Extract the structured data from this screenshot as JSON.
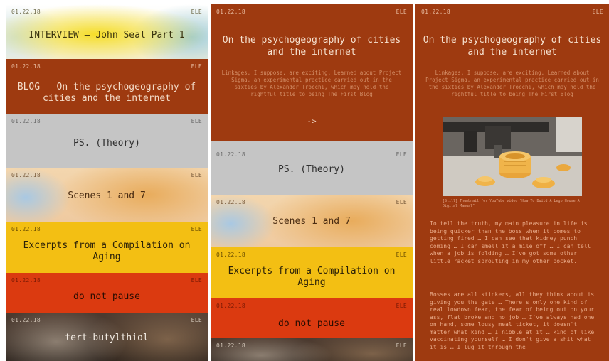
{
  "colors": {
    "rust": "#9e3a10",
    "gray": "#c5c5c5",
    "yellow": "#f3bf13",
    "red": "#db3a10",
    "white": "#ffffff"
  },
  "panel1": {
    "cards": [
      {
        "date": "01.22.18",
        "author": "ELE",
        "title": "INTERVIEW – John Seal Part 1"
      },
      {
        "date": "01.22.18",
        "author": "ELE",
        "title": "BLOG – On the psychogeography of cities and the internet"
      },
      {
        "date": "01.22.18",
        "author": "ELE",
        "title": "PS. (Theory)"
      },
      {
        "date": "01.22.18",
        "author": "ELE",
        "title": "Scenes 1 and 7"
      },
      {
        "date": "01.22.18",
        "author": "ELE",
        "title": "Excerpts from a Compilation on Aging"
      },
      {
        "date": "01.22.18",
        "author": "ELE",
        "title": "do not pause"
      },
      {
        "date": "01.22.18",
        "author": "ELE",
        "title": "tert-butylthiol"
      }
    ]
  },
  "panel2": {
    "expanded": {
      "date": "01.22.18",
      "author": "ELE",
      "title": "On the psychogeography of cities and the internet",
      "excerpt": "Linkages, I suppose, are exciting. Learned about Project Sigma, an experimental practice carried out in the sixties by Alexander Trocchi, which may hold the rightful title to being The First Blog",
      "arrow": "->"
    },
    "cards": [
      {
        "date": "01.22.18",
        "author": "ELE",
        "title": "PS. (Theory)"
      },
      {
        "date": "01.22.18",
        "author": "ELE",
        "title": "Scenes 1 and 7"
      },
      {
        "date": "01.22.18",
        "author": "ELE",
        "title": "Excerpts from a Compilation on Aging"
      },
      {
        "date": "01.22.18",
        "author": "ELE",
        "title": "do not pause"
      },
      {
        "date": "01.22.18",
        "author": "ELE",
        "title": ""
      }
    ]
  },
  "panel3": {
    "date": "01.22.18",
    "author": "ELE",
    "title": "On the psychogeography of cities and the internet",
    "excerpt": "Linkages, I suppose, are exciting. Learned about Project Sigma, an experimental practice carried out in the sixties by Alexander Trocchi, which may hold the rightful title to being The First Blog",
    "image_caption": "[Still] Thumbnail for YouTube video \"How To Build A Lego House A Digital Manual\"",
    "paragraph1": "To tell the truth, my main pleasure in life is being quicker than the boss when it comes to getting fired … I can see that kidney punch coming … I can smell it a mile off … I can tell when a job is folding … I've got some other little racket sprouting in my other pocket.",
    "paragraph2": "Bosses are all stinkers, all they think about is giving you the gate … There's only one kind of real lowdown fear, the fear of being out on your ass, flat broke and no job … I've always had one on hand, some lousy meal ticket, it doesn't matter what kind … I nibble at it … kind of like vaccinating yourself … I don't give a shit what it is … I lug it through the"
  }
}
